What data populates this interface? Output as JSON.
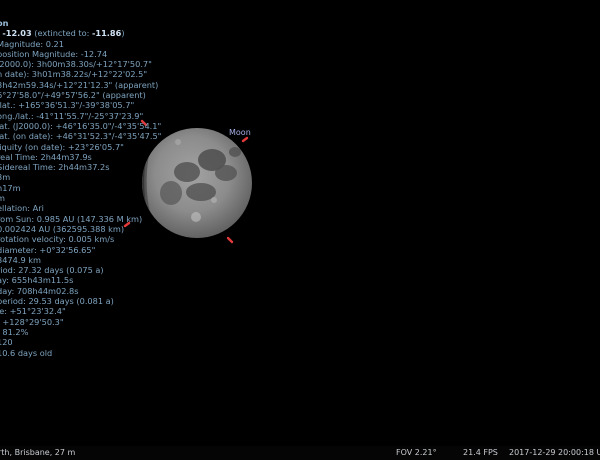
{
  "info_panel": {
    "title": "on",
    "magnitude_prefix": ": ",
    "magnitude_value": "-12.03",
    "magnitude_extincted": " (extincted to: ",
    "magnitude_extincted_value": "-11.86",
    "magnitude_suffix": ")",
    "lines": [
      "Magnitude: 0.21",
      "position Magnitude: -12.74",
      "J2000.0): 3h00m38.30s/+12°17'50.7\"",
      "n date): 3h01m38.22s/+12°22'02.5\"",
      "3h42m59.34s/+12°21'12.3\" (apparent)",
      "6°27'58.0\"/+49°57'56.2\" (apparent)",
      ".lat.: +165°36'51.3\"/-39°38'05.7\"",
      "ong./lat.: -41°11'55.7\"/-25°37'23.9\"",
      "lat. (J2000.0): +46°16'35.0\"/-4°35'54.1\"",
      "lat. (on date): +46°31'52.3\"/-4°35'47.5\"",
      "liquity (on date): +23°26'05.7\"",
      "real Time: 2h44m37.9s",
      "Sidereal Time: 2h44m37.2s",
      "3m",
      "h17m",
      "m",
      "ellation: Ari",
      "rom Sun: 0.985 AU (147.336 M km)",
      "0.002424 AU (362595.388 km)",
      "rotation velocity: 0.005 km/s",
      "diameter: +0°32'56.65\"",
      "3474.9 km",
      "riod: 27.32 days (0.075 a)",
      "ay: 655h43m11.5s",
      " day: 708h44m02.8s",
      "period: 29.53 days (0.081 a)",
      "le: +51°23'32.4\"",
      ": +128°29'50.3\"",
      ": 81.2%",
      "120",
      "10.6 days old"
    ]
  },
  "object_label": "Moon",
  "status_bar": {
    "location": "rth, Brisbane, 27 m",
    "fov": "FOV 2.21°",
    "fps": "21.4 FPS",
    "datetime": "2017-12-29 20:00:18 U"
  },
  "colors": {
    "background": "#000000",
    "info_text": "#7ea3bf",
    "label": "#a7b0e6",
    "marker": "#e23a3a",
    "status_text": "#c8ccd2"
  }
}
